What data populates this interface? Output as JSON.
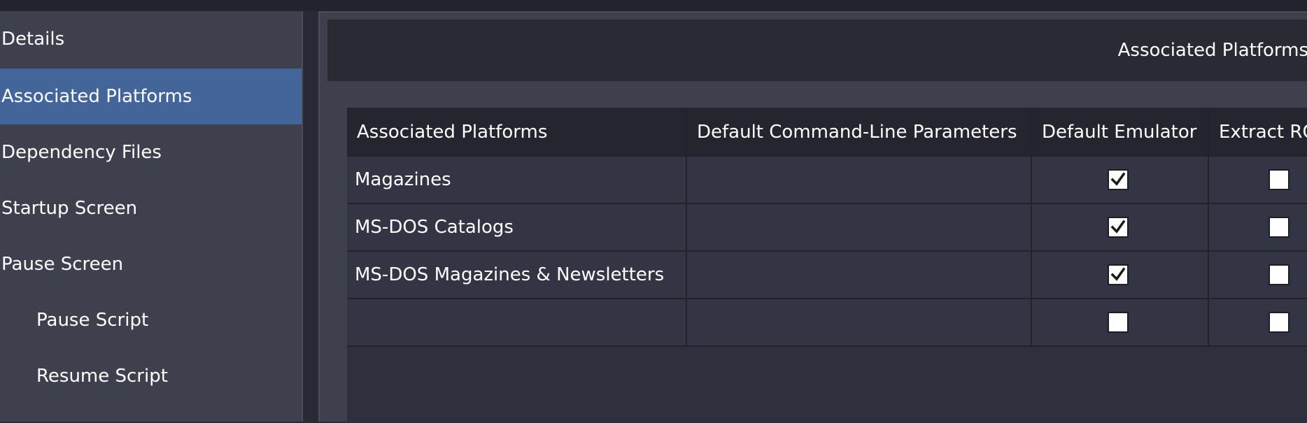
{
  "sidebar": {
    "items": [
      {
        "label": "Details",
        "selected": false,
        "child": false
      },
      {
        "label": "Associated Platforms",
        "selected": true,
        "child": false
      },
      {
        "label": "Dependency Files",
        "selected": false,
        "child": false
      },
      {
        "label": "Startup Screen",
        "selected": false,
        "child": false
      },
      {
        "label": "Pause Screen",
        "selected": false,
        "child": false
      },
      {
        "label": "Pause Script",
        "selected": false,
        "child": true
      },
      {
        "label": "Resume Script",
        "selected": false,
        "child": true
      }
    ]
  },
  "main": {
    "header_title": "Associated Platforms",
    "table": {
      "columns": [
        "Associated Platforms",
        "Default Command-Line Parameters",
        "Default Emulator",
        "Extract RO"
      ],
      "rows": [
        {
          "platform": "Magazines",
          "params": "",
          "default_emulator": true,
          "extract": false
        },
        {
          "platform": "MS-DOS Catalogs",
          "params": "",
          "default_emulator": true,
          "extract": false
        },
        {
          "platform": "MS-DOS Magazines & Newsletters",
          "params": "",
          "default_emulator": true,
          "extract": false
        },
        {
          "platform": "",
          "params": "",
          "default_emulator": false,
          "extract": false
        }
      ]
    }
  },
  "colors": {
    "background": "#2a2a35",
    "panel": "#3f404e",
    "selected": "#44659a",
    "grid_header": "#252530",
    "grid_row": "#333544"
  }
}
